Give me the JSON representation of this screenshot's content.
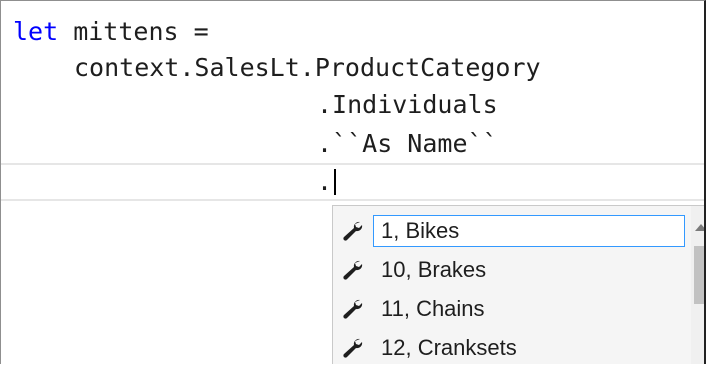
{
  "editor": {
    "lines": {
      "l1_keyword": "let",
      "l1_name": " mittens ",
      "l1_op": "=",
      "l2": "context.SalesLt.ProductCategory",
      "l3": ".Individuals",
      "l4": ".``As Name``",
      "l5": "."
    }
  },
  "completion": {
    "items": [
      {
        "label": "1, Bikes",
        "icon": "wrench-icon",
        "selected": true
      },
      {
        "label": "10, Brakes",
        "icon": "wrench-icon"
      },
      {
        "label": "11, Chains",
        "icon": "wrench-icon"
      },
      {
        "label": "12, Cranksets",
        "icon": "wrench-icon"
      }
    ]
  },
  "colors": {
    "keyword": "#0000ff",
    "selection_border": "#3399ff"
  }
}
